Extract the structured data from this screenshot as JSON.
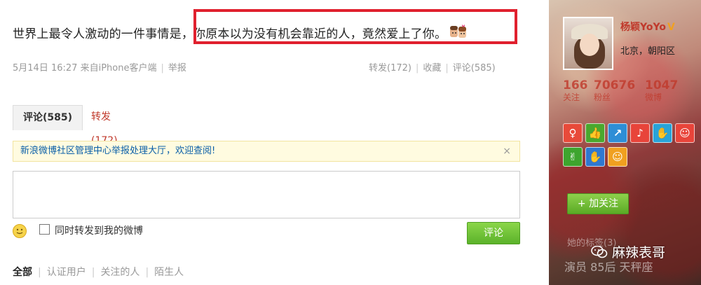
{
  "post": {
    "text_before": "世界上最令人激动的一件事情是",
    "text_highlighted": "，你原本以为没有机会靠近的人，竟然爱上了你。",
    "emoji": "couple-emoji",
    "time": "5月14日 16:27",
    "source_prefix": "来自",
    "source": "iPhone客户端",
    "report": "举报",
    "repost": "转发(172)",
    "favorite": "收藏",
    "comment": "评论(585)"
  },
  "tabs": {
    "comments": "评论(585)",
    "reposts": "转发(172)"
  },
  "notice": {
    "text": "新浪微博社区管理中心举报处理大厅，欢迎查阅!",
    "close": "×"
  },
  "composer": {
    "textarea_value": "",
    "sync_label": "同时转发到我的微博",
    "submit": "评论"
  },
  "filters": {
    "all": "全部",
    "verified": "认证用户",
    "following": "关注的人",
    "strangers": "陌生人"
  },
  "profile": {
    "name": "杨颖YoYo",
    "verified_badge": "V",
    "location": "北京，朝阳区",
    "stats": [
      {
        "value": "166",
        "label": "关注"
      },
      {
        "value": "70676",
        "label": "粉丝"
      },
      {
        "value": "1047",
        "label": "微博"
      }
    ],
    "follow_button": "+ 加关注",
    "faded_text": "她的标签(3)",
    "bottom_text": "演员 85后 天秤座"
  },
  "badges": [
    {
      "icon": "badge-icon-1",
      "color": "#e84a3a"
    },
    {
      "icon": "badge-icon-2",
      "color": "#4aa82e"
    },
    {
      "icon": "badge-icon-3",
      "color": "#2e8ed6"
    },
    {
      "icon": "badge-icon-4",
      "color": "#e8443a"
    },
    {
      "icon": "badge-icon-5",
      "color": "#29a3d8"
    },
    {
      "icon": "badge-icon-6",
      "color": "#e8443a"
    },
    {
      "icon": "badge-icon-7",
      "color": "#3ea52e"
    },
    {
      "icon": "badge-icon-8",
      "color": "#2f78d0"
    },
    {
      "icon": "badge-icon-9",
      "color": "#f0a020"
    }
  ],
  "watermark": {
    "text": "麻辣表哥",
    "icon": "wechat-icon"
  }
}
